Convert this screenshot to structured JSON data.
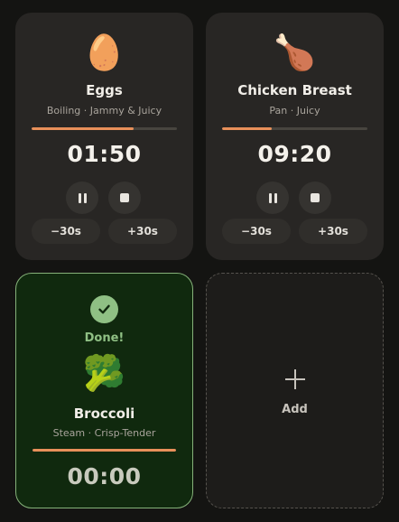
{
  "timers": [
    {
      "emoji": "🥚",
      "name": "Eggs",
      "subtitle": "Boiling · Jammy & Juicy",
      "time": "01:50",
      "progress": 0.7,
      "minus_label": "−30s",
      "plus_label": "+30s"
    },
    {
      "emoji": "🍗",
      "name": "Chicken Breast",
      "subtitle": "Pan · Juicy",
      "time": "09:20",
      "progress": 0.34,
      "minus_label": "−30s",
      "plus_label": "+30s"
    }
  ],
  "done_timer": {
    "status": "Done!",
    "emoji": "🥦",
    "name": "Broccoli",
    "subtitle": "Steam · Crisp-Tender",
    "time": "00:00",
    "progress": 1.0
  },
  "add_card": {
    "label": "Add"
  },
  "colors": {
    "accent": "#e8905a",
    "done_green": "#8fc084",
    "done_bg": "#10290e"
  }
}
